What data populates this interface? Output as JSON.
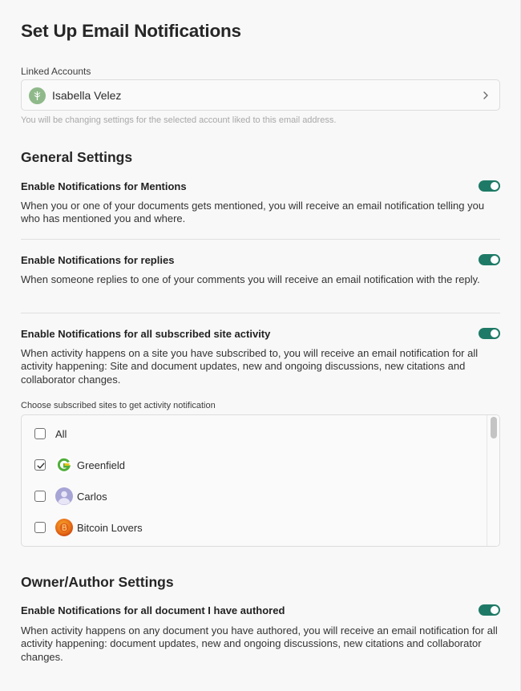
{
  "header": {
    "title": "Set Up Email Notifications"
  },
  "linked_accounts": {
    "label": "Linked Accounts",
    "selected_account": "Isabella Velez",
    "helper": "You will be changing settings for the selected account liked to this email address."
  },
  "general": {
    "title": "General Settings",
    "settings": [
      {
        "title": "Enable Notifications for Mentions",
        "description": "When you or one of your documents gets mentioned, you will receive an email notification telling you who has mentioned you and where.",
        "enabled": true
      },
      {
        "title": "Enable Notifications for replies",
        "description": "When someone replies to one of your comments you will receive an email notification with the reply.",
        "enabled": true
      },
      {
        "title": "Enable Notifications for all subscribed site activity",
        "description": "When activity happens on a site you have subscribed to, you will receive an email notification for all activity happening: Site and document updates, new and ongoing discussions, new citations and collaborator changes.",
        "enabled": true
      }
    ],
    "sites_label": "Choose subscribed sites to get activity notification",
    "sites": [
      {
        "label": "All",
        "checked": false,
        "icon": ""
      },
      {
        "label": "Greenfield",
        "checked": true,
        "icon": "greenfield-logo-icon"
      },
      {
        "label": "Carlos",
        "checked": false,
        "icon": "user-avatar-icon"
      },
      {
        "label": "Bitcoin Lovers",
        "checked": false,
        "icon": "bitcoin-logo-icon"
      }
    ]
  },
  "owner": {
    "title": "Owner/Author Settings",
    "settings": [
      {
        "title": "Enable Notifications for all document I have authored",
        "description": "When activity happens on any document you have authored, you will receive an email notification for all activity happening: document updates, new and ongoing discussions, new citations and collaborator changes.",
        "enabled": true
      }
    ]
  },
  "colors": {
    "accent": "#1e7a66",
    "border": "#dcdcdc",
    "muted": "#a8a8a8"
  }
}
